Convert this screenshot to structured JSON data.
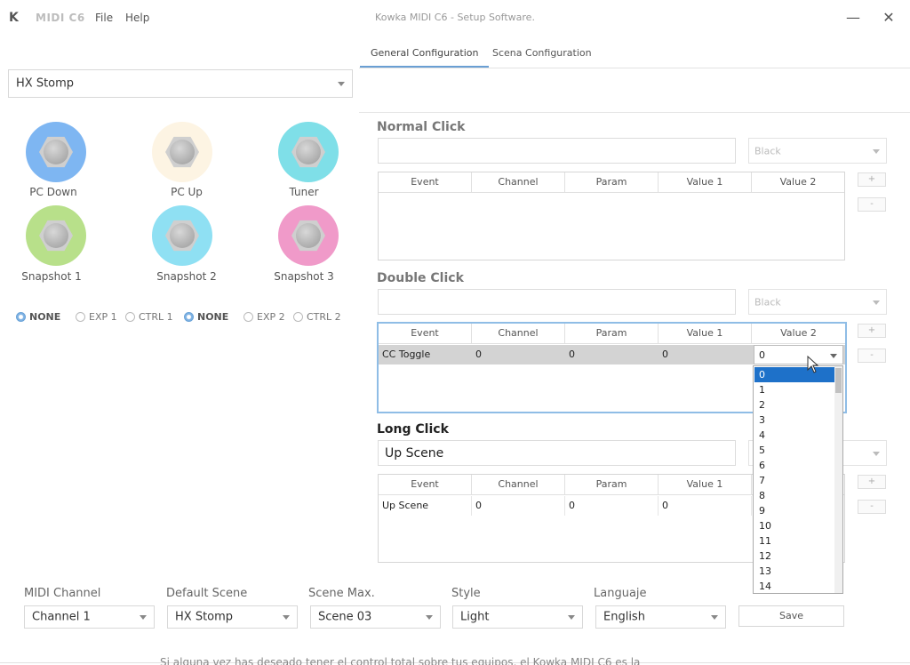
{
  "app": {
    "logo_glyph": "K",
    "name": "MIDI C6",
    "menu": [
      "File",
      "Help"
    ],
    "window_title": "Kowka MIDI C6 - Setup Software.",
    "minimize_glyph": "—",
    "close_glyph": "✕"
  },
  "tabs": [
    {
      "label": "General Configuration",
      "active": true
    },
    {
      "label": "Scena Configuration",
      "active": false
    }
  ],
  "device_select": {
    "value": "HX Stomp"
  },
  "buttons": [
    {
      "label": "PC Down",
      "color": "#7eb6f2"
    },
    {
      "label": "PC Up",
      "color": "#fdf4e3"
    },
    {
      "label": "Tuner",
      "color": "#7fdfe8"
    },
    {
      "label": "Snapshot 1",
      "color": "#b8e08a"
    },
    {
      "label": "Snapshot 2",
      "color": "#8fe0f3"
    },
    {
      "label": "Snapshot 3",
      "color": "#f09ac9"
    }
  ],
  "radios": [
    {
      "label": "NONE",
      "checked": true
    },
    {
      "label": "EXP 1",
      "checked": false
    },
    {
      "label": "CTRL 1",
      "checked": false
    },
    {
      "label": "NONE",
      "checked": true
    },
    {
      "label": "EXP 2",
      "checked": false
    },
    {
      "label": "CTRL 2",
      "checked": false
    }
  ],
  "table_headers": [
    "Event",
    "Channel",
    "Param",
    "Value 1",
    "Value 2"
  ],
  "sections": {
    "normal": {
      "title": "Normal Click",
      "name_value": "",
      "color": "Black",
      "rows": []
    },
    "double": {
      "title": "Double Click",
      "name_value": "",
      "color": "Black",
      "rows": [
        {
          "event": "CC Toggle",
          "channel": "0",
          "param": "0",
          "value1": "0",
          "value2": "0"
        }
      ]
    },
    "long": {
      "title": "Long Click",
      "name_value": "Up Scene",
      "rows": [
        {
          "event": "Up Scene",
          "channel": "0",
          "param": "0",
          "value1": "0"
        }
      ]
    }
  },
  "side_buttons": {
    "add": "+",
    "remove": "-"
  },
  "value2_dropdown": {
    "selected": "0",
    "options": [
      "0",
      "1",
      "2",
      "3",
      "4",
      "5",
      "6",
      "7",
      "8",
      "9",
      "10",
      "11",
      "12",
      "13",
      "14"
    ]
  },
  "bottom": {
    "midi_channel": {
      "label": "MIDI Channel",
      "value": "Channel 1"
    },
    "default_scene": {
      "label": "Default Scene",
      "value": "HX Stomp"
    },
    "scene_max": {
      "label": "Scene Max.",
      "value": "Scene 03"
    },
    "style": {
      "label": "Style",
      "value": "Light"
    },
    "language": {
      "label": "Languaje",
      "value": "English"
    },
    "save_label": "Save"
  },
  "bleed_text": "Si alguna vez has deseado tener el control total sobre tus equipos, el Kowka MIDI C6 es la"
}
